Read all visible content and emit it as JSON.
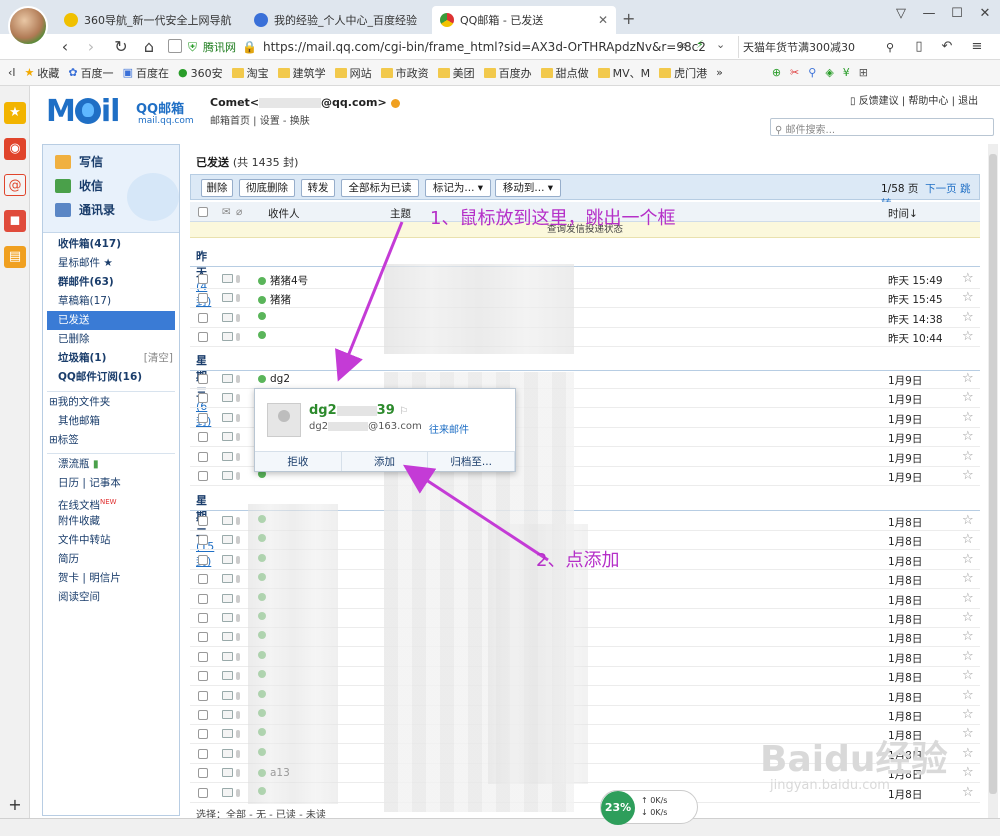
{
  "browser": {
    "tabs": [
      {
        "title": "360导航_新一代安全上网导航",
        "favicon_color": "#f0c000"
      },
      {
        "title": "我的经验_个人中心_百度经验",
        "favicon_color": "#3a70d8"
      },
      {
        "title": "QQ邮箱 - 已发送",
        "favicon_color": "#3a9b3a"
      }
    ],
    "new_tab": "+",
    "url": "https://mail.qq.com/cgi-bin/frame_html?sid=AX3d-OrTHRApdzNv&r=98c2",
    "site_badge": "腾讯网",
    "search_text": "天猫年货节满300减30",
    "bookmarks": [
      "收藏",
      "百度一",
      "百度在",
      "360安",
      "淘宝",
      "建筑学",
      "网站",
      "市政资",
      "美团",
      "百度办",
      "甜点做",
      "MV、M",
      "虎门港"
    ],
    "bookmark_back": "‹l",
    "bookmark_more": "»"
  },
  "mail": {
    "logo": "Mail",
    "logo_cn": "QQ邮箱",
    "logo_domain": "mail.qq.com",
    "user_name": "Comet",
    "user_email_suffix": "@qq.com>",
    "user_links": "邮箱首页 | 设置 - 换肤",
    "top_links": "反馈建议 | 帮助中心 | 退出",
    "search_placeholder": "邮件搜索..."
  },
  "nav": {
    "compose": "写信",
    "inbox_btn": "收信",
    "contacts": "通讯录",
    "items": [
      {
        "label": "收件箱(417)",
        "bold": true
      },
      {
        "label": "星标邮件 ★",
        "bold": false
      },
      {
        "label": "群邮件(63)",
        "bold": true
      },
      {
        "label": "草稿箱(17)",
        "bold": false
      },
      {
        "label": "已发送",
        "bold": false,
        "selected": true
      },
      {
        "label": "已删除",
        "bold": false
      },
      {
        "label": "垃圾箱(1)",
        "bold": true,
        "extra": "[清空]"
      },
      {
        "label": "QQ邮件订阅(16)",
        "bold": true
      }
    ],
    "groups": [
      "⊞我的文件夹",
      "其他邮箱",
      "⊞标签"
    ],
    "apps": [
      "漂流瓶",
      "日历 | 记事本",
      "在线文档",
      "附件收藏",
      "文件中转站",
      "简历",
      "贺卡 | 明信片",
      "阅读空间"
    ],
    "new_badge": "NEW"
  },
  "folder": {
    "title": "已发送",
    "count": "(共 1435 封)"
  },
  "toolbar": {
    "buttons": [
      "删除",
      "彻底删除",
      "转发",
      "全部标为已读",
      "标记为...",
      "移动到..."
    ],
    "page_info": "1/58 页",
    "next_page": "下一页",
    "jump": "跳转"
  },
  "columns": {
    "recipient": "收件人",
    "subject": "主题",
    "time": "时间↓"
  },
  "status_text": "查询发信投递状态",
  "groups": [
    {
      "label": "昨天",
      "count": "(4 封)",
      "rows": [
        {
          "recipient": "猪猪4号",
          "time": "昨天 15:49"
        },
        {
          "recipient": "猪猪",
          "time": "昨天 15:45"
        },
        {
          "recipient": "",
          "time": "昨天 14:38"
        },
        {
          "recipient": "",
          "time": "昨天 10:44"
        }
      ]
    },
    {
      "label": "星期三",
      "count": "(6 封)",
      "rows": [
        {
          "recipient": "dg2",
          "time": "1月9日"
        },
        {
          "recipient": "",
          "time": "1月9日"
        },
        {
          "recipient": "",
          "time": "1月9日"
        },
        {
          "recipient": "",
          "time": "1月9日"
        },
        {
          "recipient": "",
          "time": "1月9日"
        },
        {
          "recipient": "",
          "time": "1月9日"
        }
      ]
    },
    {
      "label": "星期二",
      "count": "(15 封)",
      "rows": [
        {
          "recipient": "",
          "time": "1月8日"
        },
        {
          "recipient": "",
          "time": "1月8日"
        },
        {
          "recipient": "",
          "time": "1月8日"
        },
        {
          "recipient": "",
          "time": "1月8日"
        },
        {
          "recipient": "",
          "time": "1月8日"
        },
        {
          "recipient": "",
          "time": "1月8日"
        },
        {
          "recipient": "",
          "time": "1月8日"
        },
        {
          "recipient": "",
          "time": "1月8日"
        },
        {
          "recipient": "",
          "time": "1月8日"
        },
        {
          "recipient": "",
          "time": "1月8日"
        },
        {
          "recipient": "",
          "time": "1月8日"
        },
        {
          "recipient": "",
          "time": "1月8日"
        },
        {
          "recipient": "",
          "time": "1月8日"
        },
        {
          "recipient": "a13",
          "time": "1月8日"
        },
        {
          "recipient": "",
          "time": "1月8日"
        }
      ]
    }
  ],
  "popup": {
    "name": "dg2",
    "name_suffix": "39",
    "email_prefix": "dg2",
    "email_suffix": "@163.com",
    "link": "往来邮件",
    "buttons": [
      "拒收",
      "添加",
      "归档至..."
    ]
  },
  "annotations": {
    "step1": "1、鼠标放到这里，跳出一个框",
    "step2": "2、点添加"
  },
  "footer": "选择：全部 - 无 - 已读 - 未读",
  "speed": {
    "percent": "23%",
    "up": "0K/s",
    "down": "0K/s"
  },
  "watermark": "Baidu经验",
  "watermark_sub": "jingyan.baidu.com",
  "colors": {
    "accent": "#1f6fc5",
    "selected": "#3a7bd5",
    "annotation": "#b530c8"
  }
}
